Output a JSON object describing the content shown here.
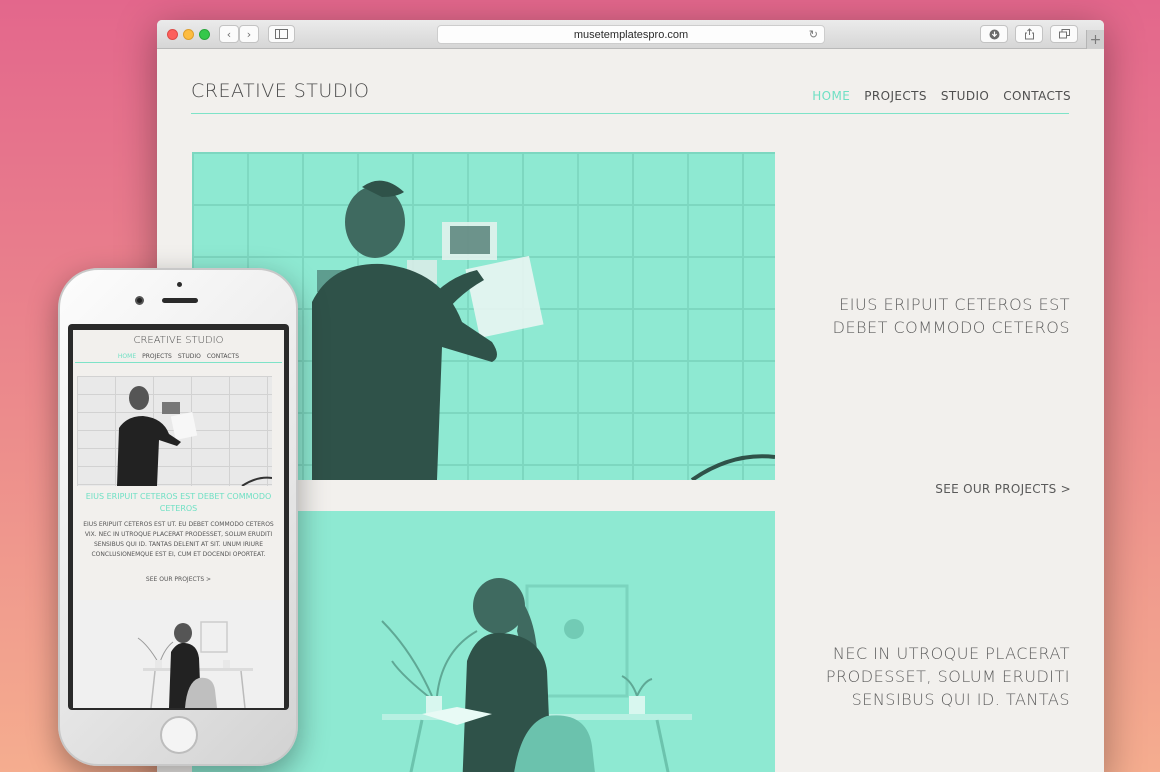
{
  "browser": {
    "url": "musetemplatespro.com",
    "buttons": {
      "back": "‹",
      "forward": "›",
      "reload": "↻",
      "new_tab": "+"
    }
  },
  "site": {
    "logo": "CREATIVE STUDIO",
    "nav": [
      {
        "label": "HOME",
        "active": true
      },
      {
        "label": "PROJECTS",
        "active": false
      },
      {
        "label": "STUDIO",
        "active": false
      },
      {
        "label": "CONTACTS",
        "active": false
      }
    ],
    "section1": {
      "headline_line1": "EIUS ERIPUIT CETEROS EST",
      "headline_line2": "DEBET COMMODO CETEROS"
    },
    "see_projects": "SEE OUR PROJECTS >",
    "section2": {
      "headline_line1": "NEC IN UTROQUE PLACERAT",
      "headline_line2": "PRODESSET, SOLUM ERUDITI",
      "headline_line3": "SENSIBUS QUI ID. TANTAS"
    }
  },
  "mobile": {
    "logo": "CREATIVE STUDIO",
    "nav": [
      "HOME",
      "PROJECTS",
      "STUDIO",
      "CONTACTS"
    ],
    "headline": "EIUS ERIPUIT CETEROS EST  DEBET COMMODO CETEROS",
    "body": "EIUS ERIPUIT CETEROS EST UT. EU DEBET COMMODO CETEROS VIX. NEC IN UTROQUE PLACERAT PRODESSET, SOLUM ERUDITI SENSIBUS QUI ID. TANTAS DELENIT AT SIT. UNUM IRIURE CONCLUSIONEMQUE EST EI, CUM ET DOCENDI OPORTEAT.",
    "see_projects": "SEE OUR PROJECTS >"
  },
  "colors": {
    "background_top": "#e3678c",
    "background_bottom": "#f5ad8f",
    "accent": "#6fe0c4",
    "photo_tint": "#8ee9d2",
    "page_bg": "#f2f0ed"
  }
}
